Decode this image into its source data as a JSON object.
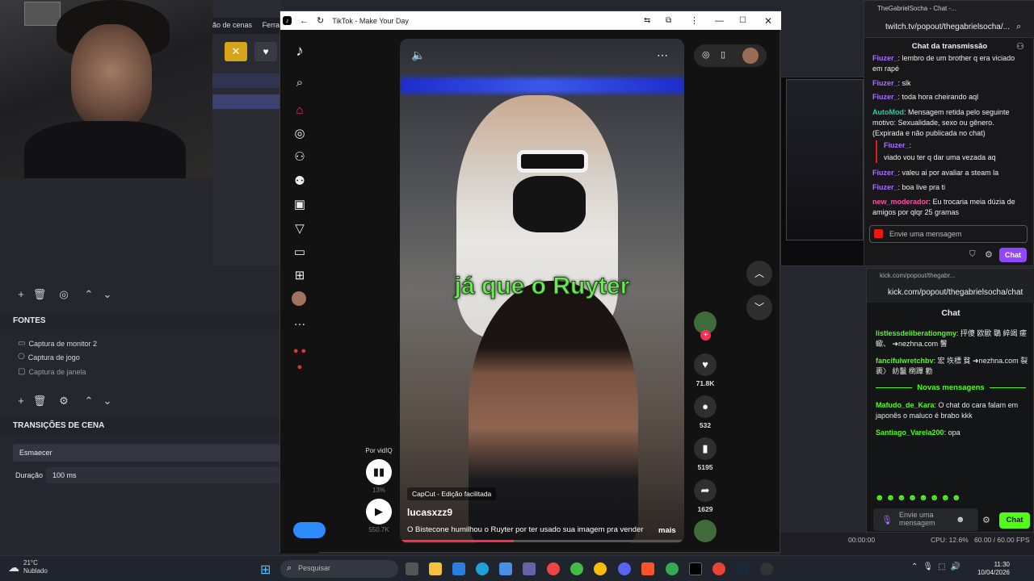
{
  "obs": {
    "menu": [
      "ão de cenas",
      "Ferram"
    ],
    "sources_title": "FONTES",
    "sources": [
      "Captura de monitor 2",
      "Captura de jogo",
      "Captura de janela"
    ],
    "transitions_title": "TRANSIÇÕES DE CENA",
    "transition_value": "Esmaecer",
    "duration_label": "Duração",
    "duration_value": "100 ms",
    "status_time": "00:00:00",
    "status_cpu": "CPU: 12.6%",
    "status_fps": "60.00 / 60.00 FPS"
  },
  "tiktok": {
    "window_title": "TikTok - Make Your Day",
    "caption_overlay": "já que o Ruyter",
    "capcut_label": "CapCut - Edição facilitada",
    "author": "lucasxzz9",
    "description": "O Bistecone humilhou o Ruyter por ter usado sua imagem pra vender",
    "more_label": "mais",
    "likes": "71.8K",
    "comments": "532",
    "saves": "5195",
    "shares": "1629",
    "vidiq_label": "Por vidIQ",
    "vidiq_pct": "13%",
    "vidiq_views": "550.7K"
  },
  "twitch": {
    "window_title": "TheGabrielSocha - Chat -...",
    "url": "twitch.tv/popout/thegabrielsocha/...",
    "header": "Chat da transmissão",
    "messages": [
      {
        "name": "Fiuzer_",
        "color": "#a970ff",
        "text": ": lembro de um brother q era viciado em rapé"
      },
      {
        "name": "Fiuzer_",
        "color": "#a970ff",
        "text": ": slk"
      },
      {
        "name": "Fiuzer_",
        "color": "#a970ff",
        "text": ": toda hora cheirando aql"
      },
      {
        "name": "AutoMod",
        "color": "#1fd1a4",
        "text": ": Mensagem retida pelo seguinte motivo: Sexualidade, sexo ou gênero. (Expirada e não publicada no chat)"
      },
      {
        "name": "Fiuzer_",
        "color": "#a970ff",
        "text": ":"
      },
      {
        "name": "",
        "color": "#efeff1",
        "text": "viado vou ter q dar uma vezada aq"
      },
      {
        "name": "Fiuzer_",
        "color": "#a970ff",
        "text": ": valeu ai por avaliar a steam la"
      },
      {
        "name": "Fiuzer_",
        "color": "#a970ff",
        "text": ": boa live pra ti"
      },
      {
        "name": "new_moderador",
        "color": "#ff4da6",
        "text": ": Eu trocaria meia dúzia de amigos por qlqr 25 gramas"
      }
    ],
    "input_placeholder": "Envie uma mensagem",
    "chat_button": "Chat"
  },
  "kick": {
    "window_title": "kick.com/popout/thegabr...",
    "url": "kick.com/popout/thegabrielsocha/chat",
    "header": "Chat",
    "messages": [
      {
        "name": "listlessdeliberationgmy",
        "text": ": 抨傻 欧歐 鸀 綷竭 瘥 蠍、 ➜nezhna.com 鬐"
      },
      {
        "name": "fancifulwretchbv",
        "text": ": 宏 垁標 貧 ➜nezhna.com 裂 裹〉 紡鬣 椡蹕 勸"
      }
    ],
    "new_messages_label": "Novas mensagens",
    "new_messages": [
      {
        "name": "Mafudo_de_Kara",
        "text": ": O chat do cara falam em japonês o maluco é brabo kkk"
      },
      {
        "name": "Santiago_Varela200",
        "text": ": opa"
      }
    ],
    "input_placeholder": "Envie uma mensagem",
    "chat_button": "Chat"
  },
  "taskbar": {
    "weather_temp": "21°C",
    "weather_desc": "Nublado",
    "search_placeholder": "Pesquisar",
    "time": "11:30",
    "date": "10/04/2026"
  }
}
